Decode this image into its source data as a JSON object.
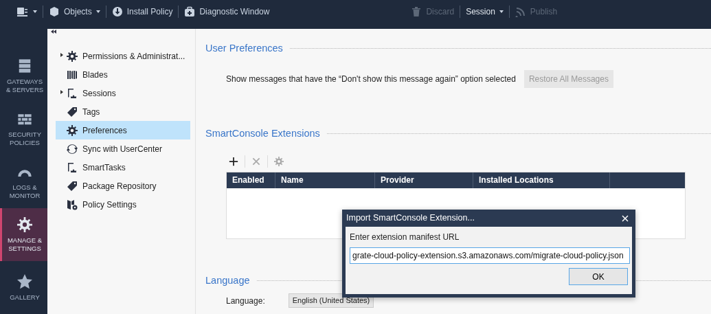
{
  "toolbar": {
    "left": [
      {
        "label": "Objects",
        "dropdown": true,
        "disabled": false
      },
      {
        "label": "Install Policy",
        "dropdown": false,
        "disabled": false
      },
      {
        "label": "Diagnostic Window",
        "dropdown": false,
        "disabled": false
      }
    ],
    "right": [
      {
        "label": "Discard",
        "dropdown": false,
        "disabled": true
      },
      {
        "label": "Session",
        "dropdown": true,
        "disabled": false
      },
      {
        "label": "Publish",
        "dropdown": false,
        "disabled": true
      }
    ]
  },
  "nav": [
    {
      "label": "GATEWAYS & SERVERS",
      "selected": false
    },
    {
      "label": "SECURITY POLICIES",
      "selected": false
    },
    {
      "label": "LOGS & MONITOR",
      "selected": false
    },
    {
      "label": "MANAGE & SETTINGS",
      "selected": true
    },
    {
      "label": "GALLERY",
      "selected": false
    }
  ],
  "tree": [
    {
      "label": "Permissions & Administrat...",
      "expandable": true,
      "selected": false
    },
    {
      "label": "Blades",
      "expandable": false,
      "selected": false
    },
    {
      "label": "Sessions",
      "expandable": true,
      "selected": false
    },
    {
      "label": "Tags",
      "expandable": false,
      "selected": false
    },
    {
      "label": "Preferences",
      "expandable": false,
      "selected": true
    },
    {
      "label": "Sync with UserCenter",
      "expandable": false,
      "selected": false
    },
    {
      "label": "SmartTasks",
      "expandable": false,
      "selected": false
    },
    {
      "label": "Package Repository",
      "expandable": false,
      "selected": false
    },
    {
      "label": "Policy Settings",
      "expandable": false,
      "selected": false
    }
  ],
  "user_preferences": {
    "title": "User Preferences",
    "message": "Show messages that have the “Don't show this message again” option selected",
    "button": {
      "label": "Restore All Messages",
      "disabled": true
    }
  },
  "extensions": {
    "title": "SmartConsole Extensions",
    "tools": [
      {
        "disabled": false
      },
      {
        "disabled": true
      },
      {
        "disabled": true
      }
    ],
    "columns": [
      "Enabled",
      "Name",
      "Provider",
      "Installed Locations"
    ]
  },
  "language": {
    "title": "Language",
    "label": "Language:",
    "value": "English (United States)"
  },
  "dialog": {
    "title": "Import SmartConsole Extension...",
    "prompt": "Enter extension manifest URL",
    "value": "grate-cloud-policy-extension.s3.amazonaws.com/migrate-cloud-policy.json",
    "button": "OK"
  }
}
